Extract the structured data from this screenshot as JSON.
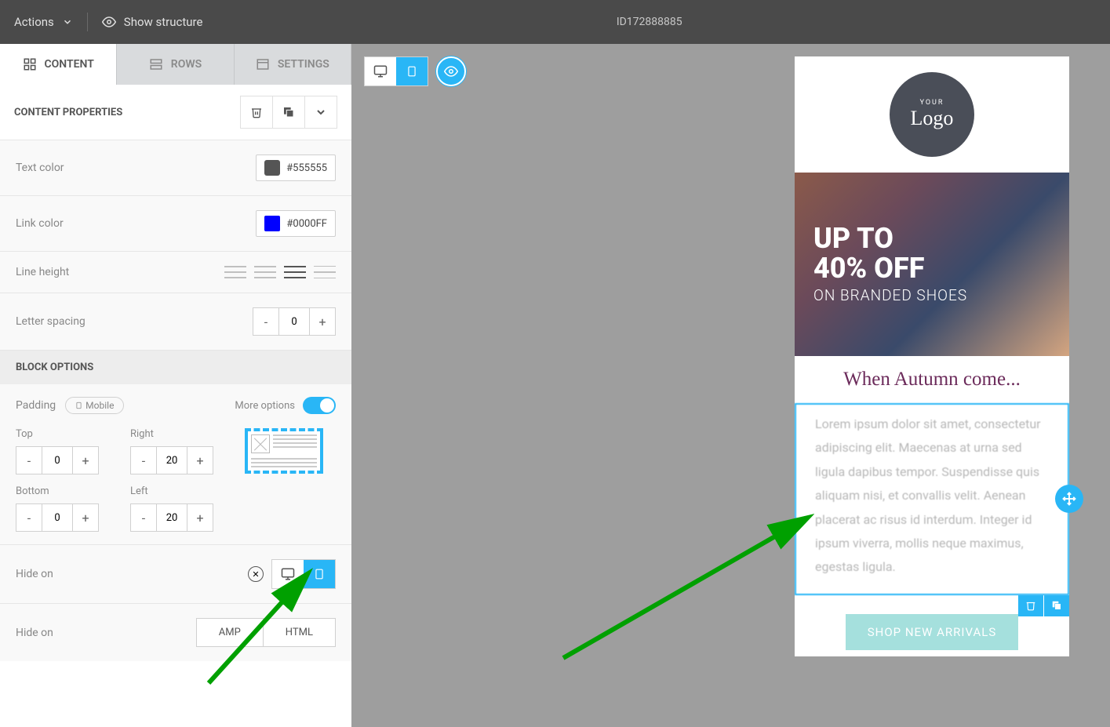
{
  "topbar": {
    "actions": "Actions",
    "show_structure": "Show structure",
    "id": "ID172888885"
  },
  "tabs": {
    "content": "CONTENT",
    "rows": "ROWS",
    "settings": "SETTINGS"
  },
  "panel_title": "CONTENT PROPERTIES",
  "props": {
    "text_color_label": "Text color",
    "text_color_value": "#555555",
    "link_color_label": "Link color",
    "link_color_value": "#0000FF",
    "line_height_label": "Line height",
    "letter_spacing_label": "Letter spacing",
    "letter_spacing_value": "0"
  },
  "block_options_title": "BLOCK OPTIONS",
  "padding": {
    "label": "Padding",
    "mobile_chip": "Mobile",
    "more_options": "More options",
    "top_label": "Top",
    "right_label": "Right",
    "bottom_label": "Bottom",
    "left_label": "Left",
    "top": "0",
    "right": "20",
    "bottom": "0",
    "left": "20"
  },
  "hide_on": {
    "label": "Hide on",
    "label2": "Hide on",
    "amp": "AMP",
    "html": "HTML"
  },
  "preview": {
    "logo_your": "YOUR",
    "logo_logo": "Logo",
    "hero_h1a": "UP TO",
    "hero_h1b": "40% OFF",
    "hero_sub": "ON BRANDED SHOES",
    "title": "When Autumn come...",
    "body": "Lorem ipsum dolor sit amet, consectetur adipiscing elit. Maecenas at urna sed ligula dapibus tempor. Suspendisse quis aliquam nisi, et convallis velit. Aenean placerat ac risus id interdum. Integer id ipsum viverra, mollis neque maximus, egestas ligula.",
    "cta": "SHOP NEW ARRIVALS"
  }
}
